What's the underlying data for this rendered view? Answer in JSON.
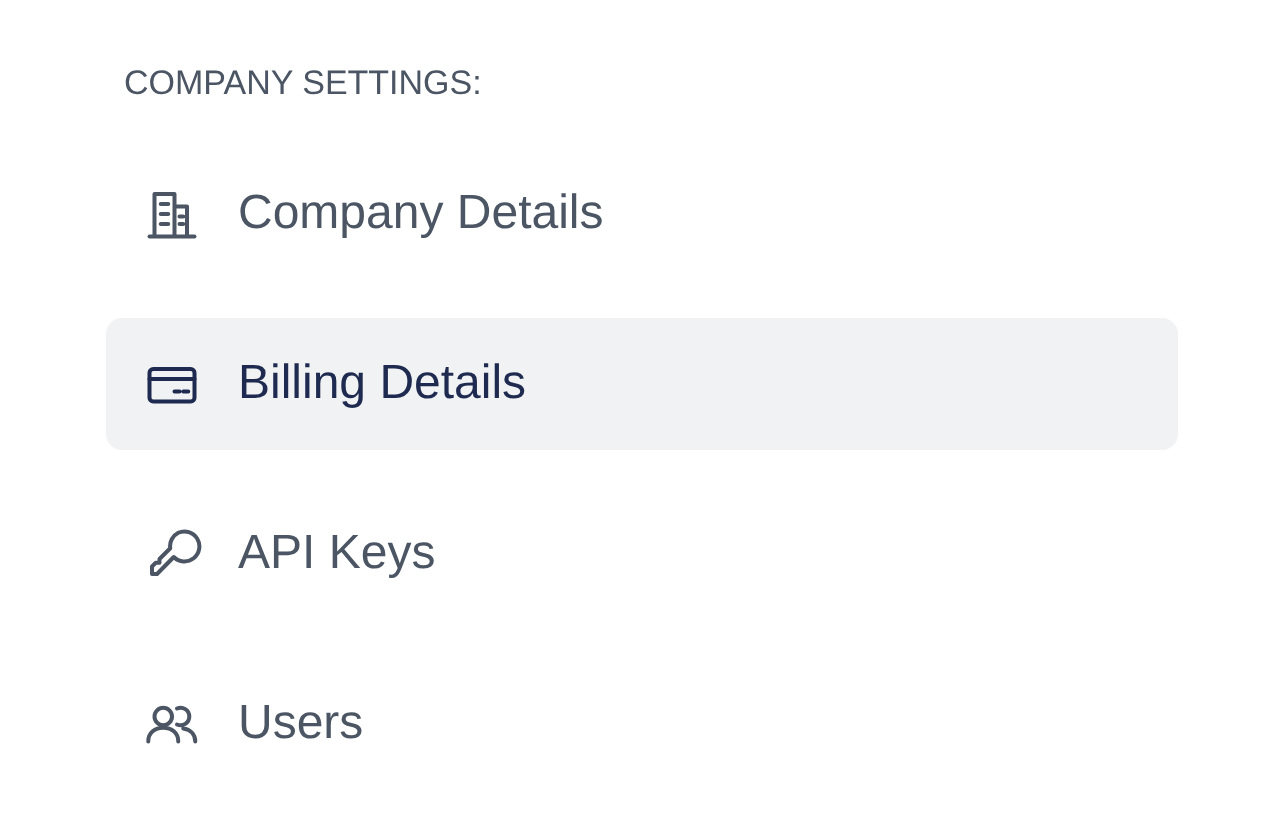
{
  "heading": "COMPANY SETTINGS:",
  "items": [
    {
      "label": "Company Details",
      "kind": "building",
      "selected": false
    },
    {
      "label": "Billing Details",
      "kind": "card",
      "selected": true
    },
    {
      "label": "API Keys",
      "kind": "key",
      "selected": false
    },
    {
      "label": "Users",
      "kind": "users",
      "selected": false
    }
  ]
}
